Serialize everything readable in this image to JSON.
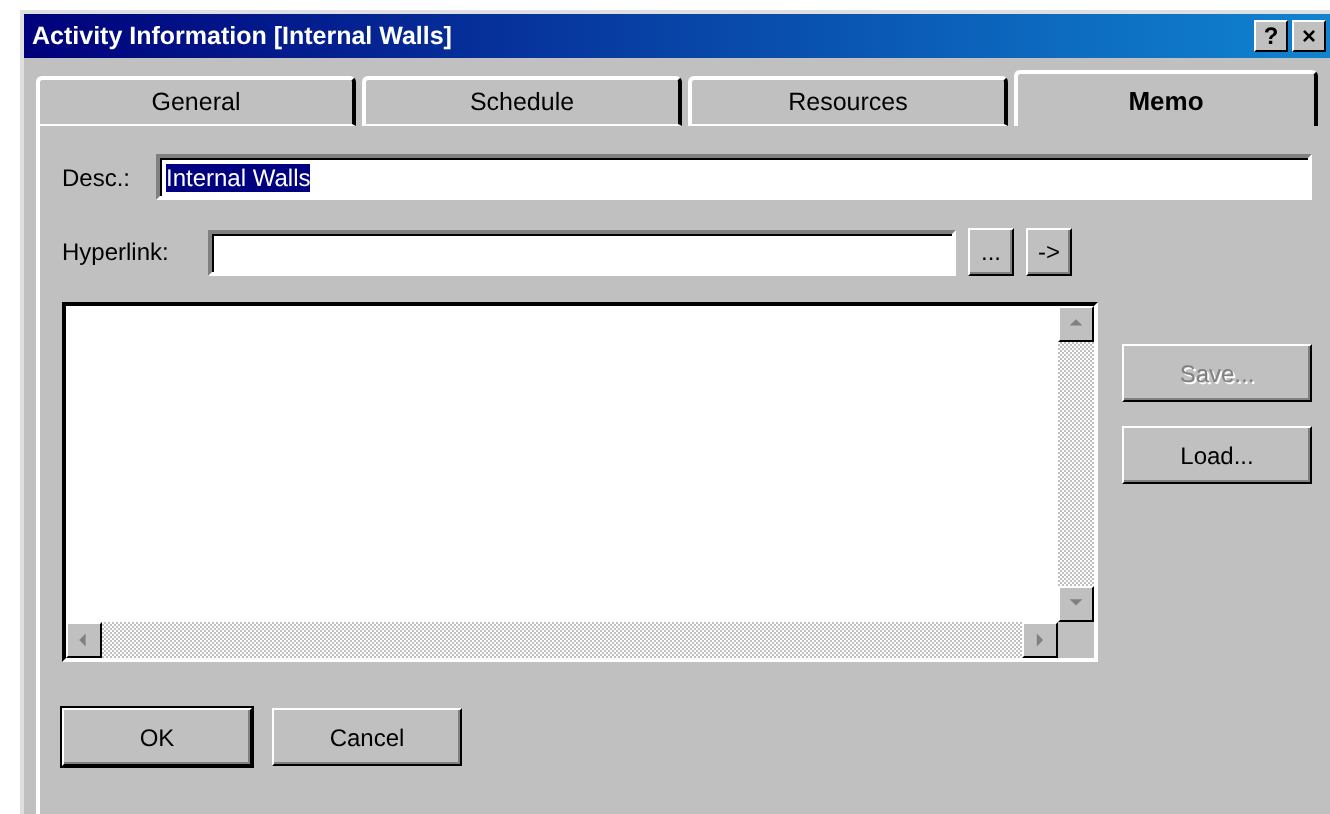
{
  "window": {
    "title": "Activity Information [Internal Walls]",
    "title_buttons": [
      "?",
      "×"
    ]
  },
  "tabs": [
    {
      "label": "General",
      "selected": false
    },
    {
      "label": "Schedule",
      "selected": false
    },
    {
      "label": "Resources",
      "selected": false
    },
    {
      "label": "Memo",
      "selected": true
    }
  ],
  "desc": {
    "label": "Desc.:",
    "value": "Internal Walls",
    "selected": true
  },
  "hyperlink": {
    "label": "Hyperlink:",
    "buttons": [
      "...",
      "->"
    ]
  },
  "memo_buttons": [
    {
      "label": "Save...",
      "disabled": true
    },
    {
      "label": "Load...",
      "disabled": false
    }
  ],
  "footer_buttons": [
    {
      "label": "OK",
      "default": true
    },
    {
      "label": "Cancel",
      "default": false
    }
  ]
}
